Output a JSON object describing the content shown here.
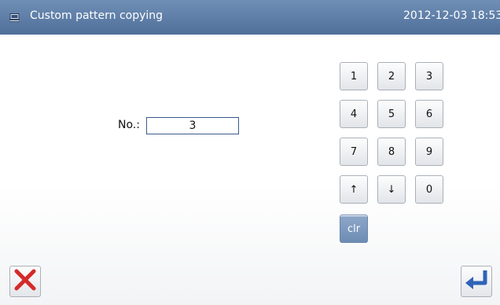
{
  "header": {
    "title": "Custom pattern copying",
    "datetime": "2012-12-03  18:53"
  },
  "form": {
    "no_label": "No.:",
    "no_value": "3"
  },
  "keypad": {
    "keys": [
      "1",
      "2",
      "3",
      "4",
      "5",
      "6",
      "7",
      "8",
      "9",
      "↑",
      "↓",
      "0"
    ],
    "clear_label": "clr"
  },
  "icons": {
    "title": "monitor-icon",
    "cancel": "close-x-icon",
    "confirm": "enter-return-icon"
  },
  "colors": {
    "titlebar": "#5a7aa6",
    "cancel": "#d42a2a",
    "confirm": "#2f63b8",
    "clear_key": "#7895bd"
  }
}
